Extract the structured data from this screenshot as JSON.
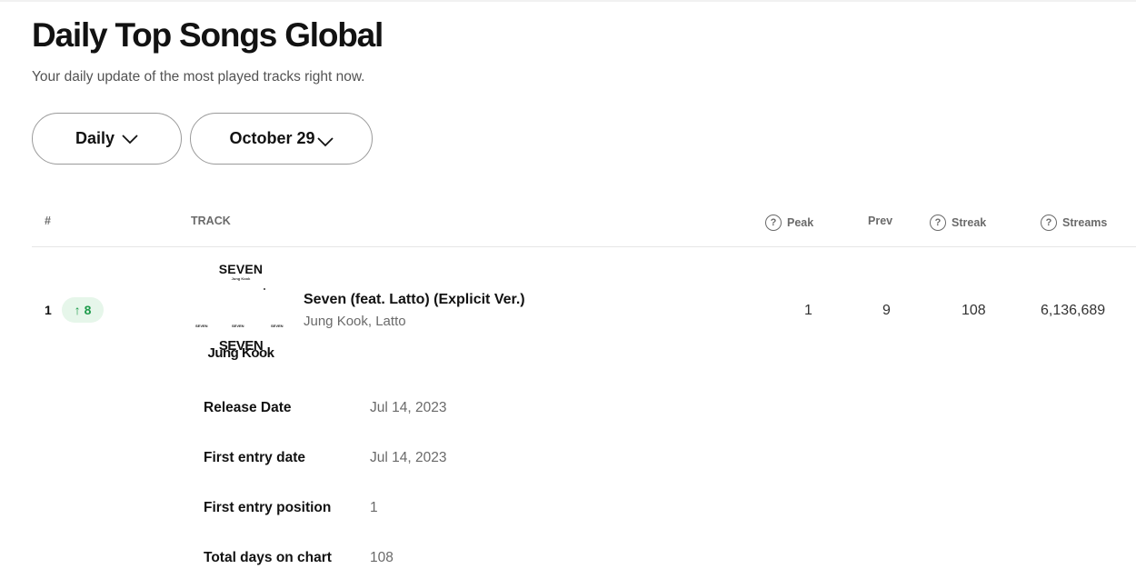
{
  "page": {
    "title": "Daily Top Songs Global",
    "subtitle": "Your daily update of the most played tracks right now."
  },
  "filters": {
    "frequency": "Daily",
    "date": "October 29"
  },
  "table": {
    "headers": {
      "rank": "#",
      "track": "TRACK",
      "peak": "Peak",
      "prev": "Prev",
      "streak": "Streak",
      "streams": "Streams"
    },
    "rows": [
      {
        "rank": "1",
        "movement": "8",
        "movement_direction": "up",
        "title": "Seven (feat. Latto) (Explicit Ver.)",
        "artists": "Jung Kook, Latto",
        "peak": "1",
        "prev": "9",
        "streak": "108",
        "streams": "6,136,689",
        "album_art": {
          "title": "SEVEN",
          "artist": "Jung Kook",
          "mini_label": "SEVEN",
          "mini_label_center": "SEVEN",
          "bottom_title": "SEVEN",
          "bottom_artist": "Jung Kook"
        }
      }
    ]
  },
  "details": [
    {
      "label": "Release Date",
      "value": "Jul 14, 2023"
    },
    {
      "label": "First entry date",
      "value": "Jul 14, 2023"
    },
    {
      "label": "First entry position",
      "value": "1"
    },
    {
      "label": "Total days on chart",
      "value": "108"
    }
  ],
  "colors": {
    "movement_up_bg": "#e6f6ea",
    "movement_up_text": "#1e9b4b",
    "text_primary": "#121212",
    "text_secondary": "#6a6a6a"
  },
  "icons": {
    "dropdown": "chevron-down-icon",
    "help": "question-circle-icon",
    "movement": "arrow-up-icon"
  }
}
